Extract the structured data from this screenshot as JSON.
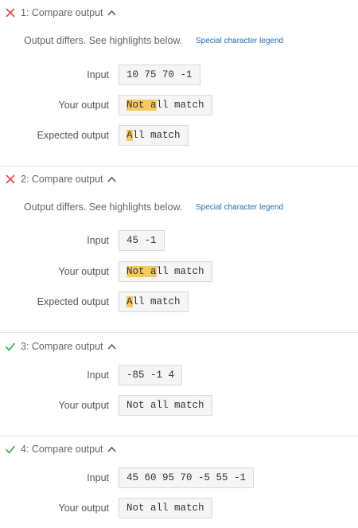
{
  "tests": [
    {
      "status": "fail",
      "title": "1: Compare output",
      "message": "Output differs. See highlights below.",
      "legend_link": "Special character legend",
      "input_label": "Input",
      "input_value": "10 75 70 -1",
      "your_label": "Your output",
      "your_highlight": "Not a",
      "your_rest": "ll match",
      "expected_label": "Expected output",
      "expected_highlight": "A",
      "expected_rest": "ll match"
    },
    {
      "status": "fail",
      "title": "2: Compare output",
      "message": "Output differs. See highlights below.",
      "legend_link": "Special character legend",
      "input_label": "Input",
      "input_value": "45 -1",
      "your_label": "Your output",
      "your_highlight": "Not a",
      "your_rest": "ll match",
      "expected_label": "Expected output",
      "expected_highlight": "A",
      "expected_rest": "ll match"
    },
    {
      "status": "pass",
      "title": "3: Compare output",
      "input_label": "Input",
      "input_value": "-85 -1 4",
      "your_label": "Your output",
      "your_value": "Not all match"
    },
    {
      "status": "pass",
      "title": "4: Compare output",
      "input_label": "Input",
      "input_value": "45 60 95 70 -5 55 -1",
      "your_label": "Your output",
      "your_value": "Not all match"
    }
  ],
  "colors": {
    "fail": "#e0483e",
    "pass": "#3aa657",
    "highlight": "#f6c863",
    "link": "#1f6fb2"
  }
}
